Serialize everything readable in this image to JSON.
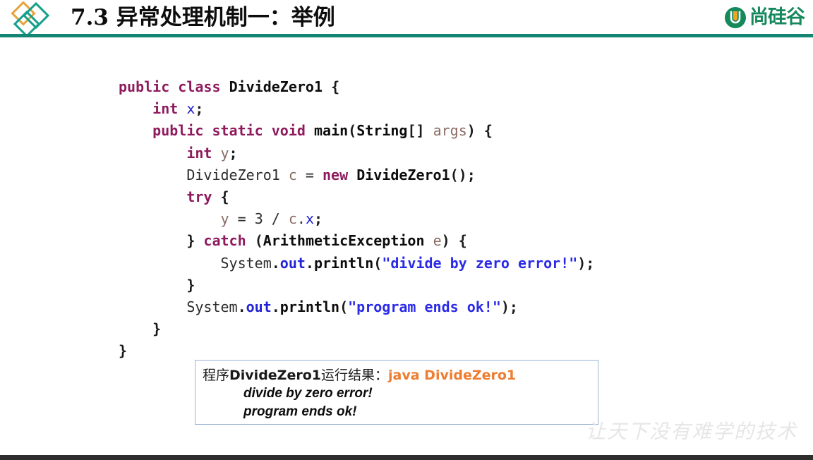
{
  "header": {
    "title": "7.3 异常处理机制一：举例",
    "left_logo_name": "diamond-logo",
    "brand_name": "尚硅谷",
    "brand_mark_letter": "U",
    "rule_color": "#138573",
    "brand_color": "#16895c",
    "accent_orange": "#ed9b2d"
  },
  "code": {
    "language": "java",
    "lines": [
      [
        {
          "t": "public",
          "c": "kw"
        },
        {
          "t": " ",
          "c": "pln"
        },
        {
          "t": "class",
          "c": "kw"
        },
        {
          "t": " ",
          "c": "pln"
        },
        {
          "t": "DivideZero1",
          "c": "typ"
        },
        {
          "t": " ",
          "c": "pln"
        },
        {
          "t": "{",
          "c": "pun"
        }
      ],
      [
        {
          "t": "    ",
          "c": "pln"
        },
        {
          "t": "int",
          "c": "kw"
        },
        {
          "t": " ",
          "c": "pln"
        },
        {
          "t": "x",
          "c": "var"
        },
        {
          "t": ";",
          "c": "pun"
        }
      ],
      [
        {
          "t": "    ",
          "c": "pln"
        },
        {
          "t": "public",
          "c": "kw"
        },
        {
          "t": " ",
          "c": "pln"
        },
        {
          "t": "static",
          "c": "kw"
        },
        {
          "t": " ",
          "c": "pln"
        },
        {
          "t": "void",
          "c": "kw"
        },
        {
          "t": " ",
          "c": "pln"
        },
        {
          "t": "main",
          "c": "typ"
        },
        {
          "t": "(",
          "c": "pun"
        },
        {
          "t": "String",
          "c": "typ"
        },
        {
          "t": "[]",
          "c": "pun"
        },
        {
          "t": " ",
          "c": "pln"
        },
        {
          "t": "args",
          "c": "mut"
        },
        {
          "t": ")",
          "c": "pun"
        },
        {
          "t": " ",
          "c": "pln"
        },
        {
          "t": "{",
          "c": "pun"
        }
      ],
      [
        {
          "t": "        ",
          "c": "pln"
        },
        {
          "t": "int",
          "c": "kw"
        },
        {
          "t": " ",
          "c": "pln"
        },
        {
          "t": "y",
          "c": "mut"
        },
        {
          "t": ";",
          "c": "pun"
        }
      ],
      [
        {
          "t": "        ",
          "c": "pln"
        },
        {
          "t": "DivideZero1",
          "c": "pln"
        },
        {
          "t": " ",
          "c": "pln"
        },
        {
          "t": "c",
          "c": "mut"
        },
        {
          "t": " ",
          "c": "pln"
        },
        {
          "t": "=",
          "c": "pln"
        },
        {
          "t": " ",
          "c": "pln"
        },
        {
          "t": "new",
          "c": "kw"
        },
        {
          "t": " ",
          "c": "pln"
        },
        {
          "t": "DivideZero1",
          "c": "typ"
        },
        {
          "t": "();",
          "c": "pun"
        }
      ],
      [
        {
          "t": "        ",
          "c": "pln"
        },
        {
          "t": "try",
          "c": "kw"
        },
        {
          "t": " ",
          "c": "pln"
        },
        {
          "t": "{",
          "c": "pun"
        }
      ],
      [
        {
          "t": "            ",
          "c": "pln"
        },
        {
          "t": "y",
          "c": "mut"
        },
        {
          "t": " ",
          "c": "pln"
        },
        {
          "t": "=",
          "c": "pln"
        },
        {
          "t": " ",
          "c": "pln"
        },
        {
          "t": "3",
          "c": "pln"
        },
        {
          "t": " ",
          "c": "pln"
        },
        {
          "t": "/",
          "c": "pln"
        },
        {
          "t": " ",
          "c": "pln"
        },
        {
          "t": "c",
          "c": "mut"
        },
        {
          "t": ".",
          "c": "pln"
        },
        {
          "t": "x",
          "c": "var"
        },
        {
          "t": ";",
          "c": "pun"
        }
      ],
      [
        {
          "t": "        ",
          "c": "pln"
        },
        {
          "t": "}",
          "c": "pun"
        },
        {
          "t": " ",
          "c": "pln"
        },
        {
          "t": "catch",
          "c": "kw"
        },
        {
          "t": " ",
          "c": "pln"
        },
        {
          "t": "(",
          "c": "pun"
        },
        {
          "t": "ArithmeticException",
          "c": "typ"
        },
        {
          "t": " ",
          "c": "pln"
        },
        {
          "t": "e",
          "c": "mut"
        },
        {
          "t": ")",
          "c": "pun"
        },
        {
          "t": " ",
          "c": "pln"
        },
        {
          "t": "{",
          "c": "pun"
        }
      ],
      [
        {
          "t": "            ",
          "c": "pln"
        },
        {
          "t": "System",
          "c": "pln"
        },
        {
          "t": ".",
          "c": "pun"
        },
        {
          "t": "out",
          "c": "mth"
        },
        {
          "t": ".",
          "c": "pun"
        },
        {
          "t": "println",
          "c": "typ"
        },
        {
          "t": "(",
          "c": "pun"
        },
        {
          "t": "\"divide by zero error!\"",
          "c": "str"
        },
        {
          "t": ");",
          "c": "pun"
        }
      ],
      [
        {
          "t": "        ",
          "c": "pln"
        },
        {
          "t": "}",
          "c": "pun"
        }
      ],
      [
        {
          "t": "        ",
          "c": "pln"
        },
        {
          "t": "System",
          "c": "pln"
        },
        {
          "t": ".",
          "c": "pun"
        },
        {
          "t": "out",
          "c": "mth"
        },
        {
          "t": ".",
          "c": "pun"
        },
        {
          "t": "println",
          "c": "typ"
        },
        {
          "t": "(",
          "c": "pun"
        },
        {
          "t": "\"program ends ok!\"",
          "c": "str"
        },
        {
          "t": ");",
          "c": "pun"
        }
      ],
      [
        {
          "t": "    ",
          "c": "pln"
        },
        {
          "t": "}",
          "c": "pun"
        }
      ],
      [
        {
          "t": "}",
          "c": "pun"
        }
      ]
    ]
  },
  "output_box": {
    "label_prefix": "程序",
    "label_class": "DivideZero1",
    "label_suffix": "运行结果：",
    "command": "java DivideZero1",
    "command_color": "#ed7d31",
    "border_color": "#9cb3d4",
    "result_lines": [
      "divide by zero error!",
      "program ends ok!"
    ]
  },
  "footer": {
    "watermark": "让天下没有难学的技术",
    "bar_color": "#2e2e2e"
  }
}
